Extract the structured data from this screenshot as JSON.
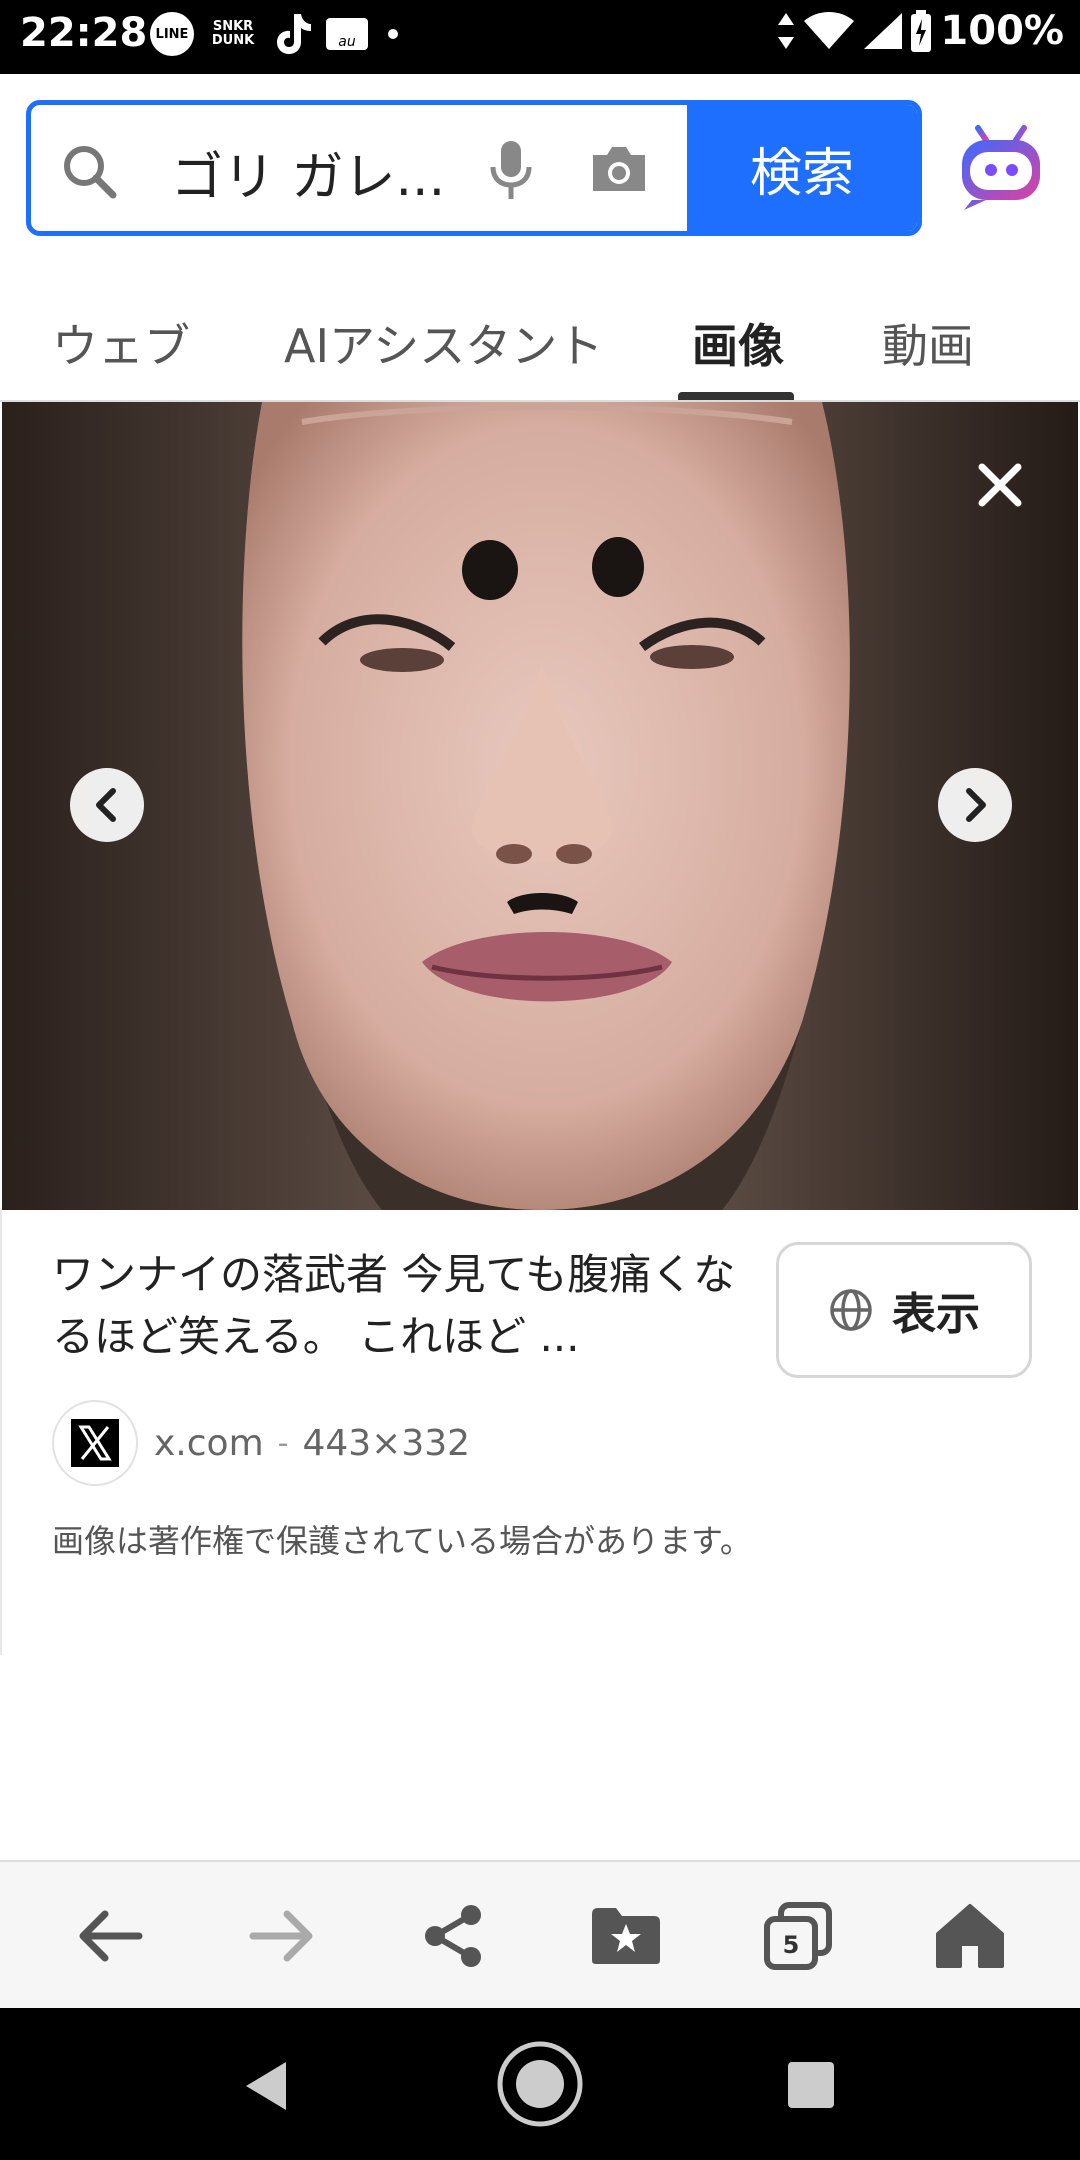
{
  "status_bar": {
    "time": "22:28",
    "app_icons": [
      "LINE",
      "SNKR DUNK",
      "tiktok-icon",
      "au-mail-icon"
    ],
    "snkr_line1": "SNKR",
    "snkr_line2": "DUNK",
    "line_label": "LINE",
    "mail_label": "au",
    "battery": "100%"
  },
  "search": {
    "query": "ゴリ ガレ...",
    "button_label": "検索",
    "accent_color": "#1f6fff"
  },
  "tabs": [
    {
      "label": "ウェブ",
      "active": false
    },
    {
      "label": "AIアシスタント",
      "active": false
    },
    {
      "label": "画像",
      "active": true
    },
    {
      "label": "動画",
      "active": false
    }
  ],
  "result": {
    "title": "ワンナイの落武者 今見ても腹痛くなるほど笑える。 これほど ...",
    "show_button_label": "表示",
    "source_domain": "x.com",
    "separator": "-",
    "image_size": "443×332",
    "copyright_notice": "画像は著作権で保護されている場合があります。"
  },
  "toolbar": {
    "tabs_count": "5",
    "buttons": [
      "back-icon",
      "forward-icon",
      "share-icon",
      "bookmark-folder-icon",
      "tabs-icon",
      "home-icon"
    ]
  }
}
